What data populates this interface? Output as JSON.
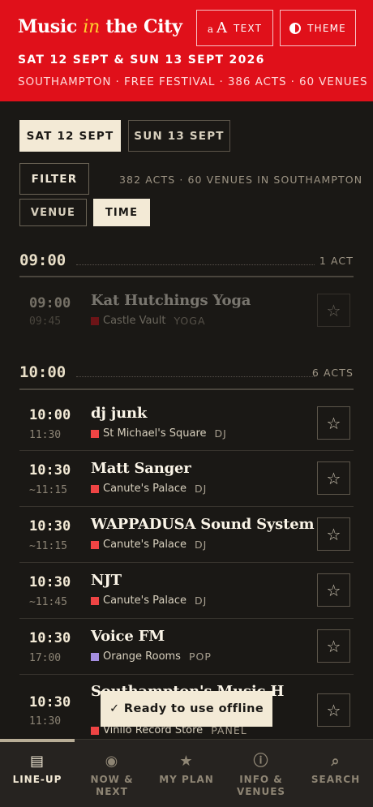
{
  "header": {
    "brand_pre": "Music ",
    "brand_in": "in",
    "brand_post": " the City",
    "text_btn_small": "a",
    "text_btn_big": "A",
    "text_btn_label": "TEXT",
    "theme_btn_label": "THEME",
    "dates": "SAT 12 SEPT & SUN 13 SEPT 2026",
    "meta": "SOUTHAMPTON · FREE FESTIVAL · 386 ACTS · 60 VENUES"
  },
  "day_tabs": [
    "SAT 12 SEPT",
    "SUN 13 SEPT"
  ],
  "filter_label": "FILTER",
  "count_text": "382 ACTS · 60 VENUES IN SOUTHAMPTON",
  "sort": {
    "venue": "VENUE",
    "time": "TIME"
  },
  "groups": [
    {
      "hour": "09:00",
      "acts_count": "1 ACT"
    },
    {
      "hour": "10:00",
      "acts_count": "6 ACTS"
    }
  ],
  "acts": [
    {
      "start": "09:00",
      "end": "09:45",
      "name": "Kat Hutchings Yoga",
      "venue": "Castle Vault",
      "genre": "YOGA",
      "color": "#e0101a"
    },
    {
      "start": "10:00",
      "end": "11:30",
      "name": "dj junk",
      "venue": "St Michael's Square",
      "genre": "DJ",
      "color": "#ee4444"
    },
    {
      "start": "10:30",
      "end": "~11:15",
      "name": "Matt Sanger",
      "venue": "Canute's Palace",
      "genre": "DJ",
      "color": "#ee4444"
    },
    {
      "start": "10:30",
      "end": "~11:15",
      "name": "WAPPADUSA Sound System",
      "venue": "Canute's Palace",
      "genre": "DJ",
      "color": "#ee4444"
    },
    {
      "start": "10:30",
      "end": "~11:45",
      "name": "NJT",
      "venue": "Canute's Palace",
      "genre": "DJ",
      "color": "#ee4444"
    },
    {
      "start": "10:30",
      "end": "17:00",
      "name": "Voice FM",
      "venue": "Orange Rooms",
      "genre": "POP",
      "color": "#a48ee0"
    },
    {
      "start": "10:30",
      "end": "11:30",
      "name": "Southampton's Music H",
      "venue": "Vinilo Record Store",
      "genre": "PANEL",
      "color": "#ee4444"
    }
  ],
  "star_icon": "☆",
  "toast": "✓ Ready to use offline",
  "nav": [
    {
      "icon": "▤",
      "label": "LINE-UP"
    },
    {
      "icon": "◉",
      "label": "NOW & NEXT"
    },
    {
      "icon": "★",
      "label": "MY PLAN"
    },
    {
      "icon": "ⓘ",
      "label": "INFO &",
      "label2": "VENUES"
    },
    {
      "icon": "⌕",
      "label": "SEARCH"
    }
  ]
}
